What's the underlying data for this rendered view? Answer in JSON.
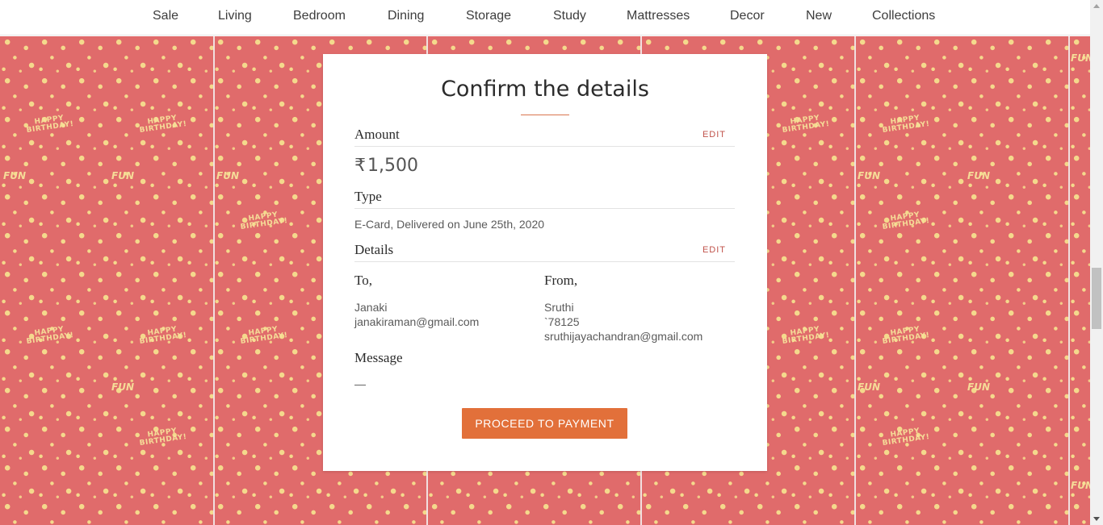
{
  "nav": {
    "items": [
      "Sale",
      "Living",
      "Bedroom",
      "Dining",
      "Storage",
      "Study",
      "Mattresses",
      "Decor",
      "New",
      "Collections"
    ]
  },
  "background": {
    "pattern_words": [
      "HAPPY",
      "BIRTHDAY!",
      "FUN"
    ],
    "color": "#e06b6b",
    "doodle_color": "#f7e19a"
  },
  "card": {
    "title": "Confirm the details",
    "amount_section": {
      "label": "Amount",
      "edit": "EDIT",
      "currency_symbol": "₹",
      "value": "1,500"
    },
    "type_section": {
      "label": "Type",
      "value": "E-Card, Delivered on June 25th, 2020"
    },
    "details_section": {
      "label": "Details",
      "edit": "EDIT",
      "to": {
        "label": "To,",
        "name": "Janaki",
        "email": "janakiraman@gmail.com"
      },
      "from": {
        "label": "From,",
        "name": "Sruthi",
        "phone": "`78125",
        "email": "sruthijayachandran@gmail.com"
      }
    },
    "message_section": {
      "label": "Message",
      "value": "—"
    },
    "cta_label": "PROCEED TO PAYMENT"
  },
  "colors": {
    "accent": "#e2703a",
    "edit_link": "#c0524a"
  }
}
